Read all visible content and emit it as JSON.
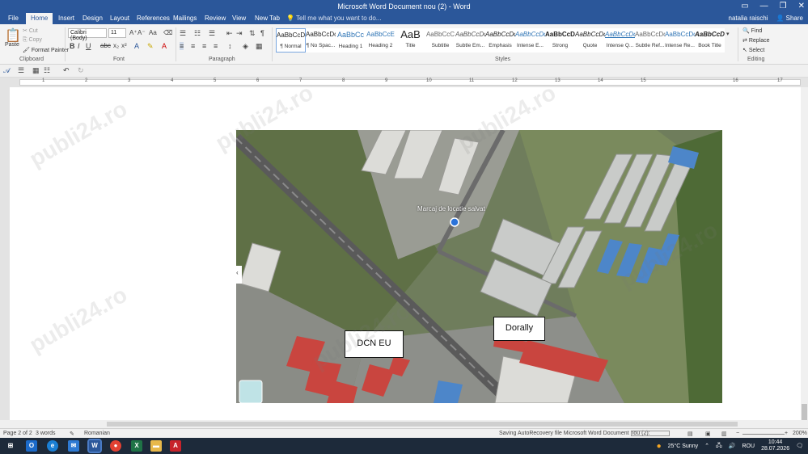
{
  "window": {
    "title": "Microsoft Word Document nou (2) - Word",
    "controls": [
      "▭",
      "—",
      "❐",
      "✕"
    ]
  },
  "tabs": [
    "File",
    "Home",
    "Insert",
    "Design",
    "Layout",
    "References",
    "Mailings",
    "Review",
    "View",
    "New Tab"
  ],
  "active_tab": "Home",
  "tell_me": "Tell me what you want to do...",
  "user": {
    "name": "natalia raischi",
    "share": "Share"
  },
  "ribbon": {
    "clipboard": {
      "label": "Clipboard",
      "paste": "Paste",
      "cut": "Cut",
      "copy": "Copy",
      "format_painter": "Format Painter"
    },
    "font": {
      "label": "Font",
      "name": "Calibri (Body)",
      "size": "11"
    },
    "paragraph": {
      "label": "Paragraph"
    },
    "styles": {
      "label": "Styles",
      "items": [
        {
          "sample": "AaBbCcDc",
          "name": "¶ Normal"
        },
        {
          "sample": "AaBbCcDc",
          "name": "¶ No Spac..."
        },
        {
          "sample": "AaBbCc",
          "name": "Heading 1"
        },
        {
          "sample": "AaBbCcE",
          "name": "Heading 2"
        },
        {
          "sample": "AaB",
          "name": "Title"
        },
        {
          "sample": "AaBbCcC",
          "name": "Subtitle"
        },
        {
          "sample": "AaBbCcDc",
          "name": "Subtle Em..."
        },
        {
          "sample": "AaBbCcDc",
          "name": "Emphasis"
        },
        {
          "sample": "AaBbCcDc",
          "name": "Intense E..."
        },
        {
          "sample": "AaBbCcDc",
          "name": "Strong"
        },
        {
          "sample": "AaBbCcDc",
          "name": "Quote"
        },
        {
          "sample": "AaBbCcDc",
          "name": "Intense Q..."
        },
        {
          "sample": "AaBbCcDc",
          "name": "Subtle Ref..."
        },
        {
          "sample": "AaBbCcDc",
          "name": "Intense Re..."
        },
        {
          "sample": "AaBbCcDc",
          "name": "Book Title"
        }
      ]
    },
    "editing": {
      "label": "Editing",
      "find": "Find",
      "replace": "Replace",
      "select": "Select"
    }
  },
  "ruler_numbers": [
    "1",
    "2",
    "3",
    "4",
    "5",
    "6",
    "7",
    "8",
    "9",
    "10",
    "11",
    "12",
    "13",
    "14",
    "15",
    "16",
    "17"
  ],
  "map": {
    "marker_text": "Marcaj de locatie salvat",
    "label_1": "DCN EU",
    "label_2": "Dorally"
  },
  "watermark": "publi24.ro",
  "status": {
    "page": "Page 2 of 2",
    "words": "3 words",
    "language": "Romanian",
    "autosave": "Saving AutoRecovery file Microsoft Word Document nou (2):",
    "zoom": "200%"
  },
  "taskbar": {
    "weather": "25°C  Sunny",
    "lang": "ROU",
    "time": "10:44",
    "date": "28.07.2026"
  }
}
